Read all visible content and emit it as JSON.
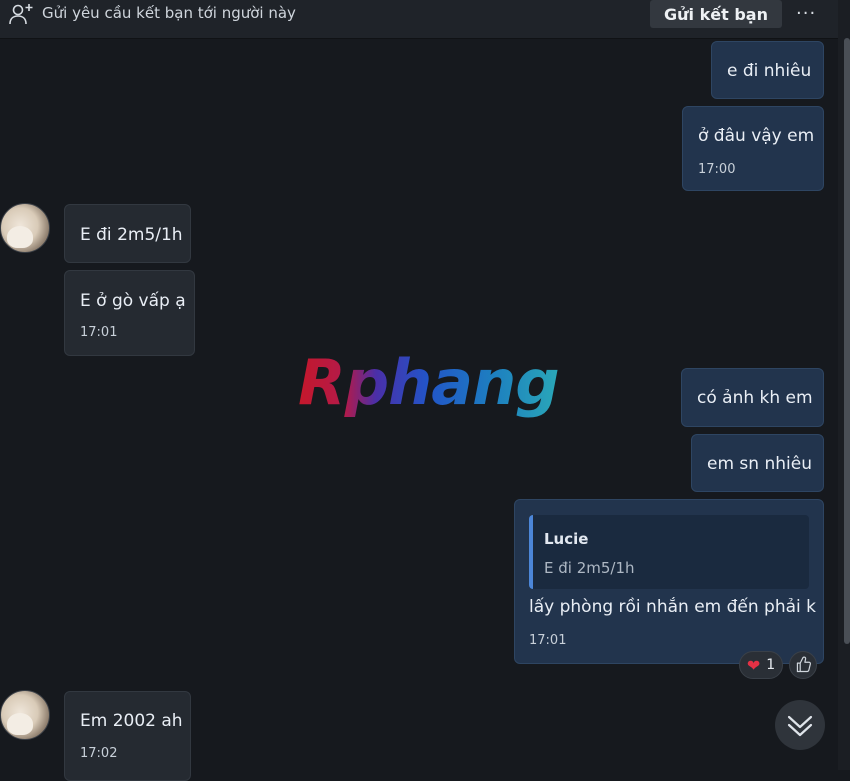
{
  "topbar": {
    "friend_request_text": "Gửi yêu cầu kết bạn tới người này",
    "add_friend_label": "Gửi kết bạn",
    "more_label": "···"
  },
  "messages": [
    {
      "dir": "out",
      "text": "e đi nhiêu",
      "time": ""
    },
    {
      "dir": "out",
      "text": "ở đâu vậy em",
      "time": "17:00"
    },
    {
      "dir": "in",
      "text": "E đi 2m5/1h",
      "time": ""
    },
    {
      "dir": "in",
      "text": "E ở gò vấp ạ",
      "time": "17:01"
    },
    {
      "dir": "out",
      "text": "có ảnh kh em",
      "time": ""
    },
    {
      "dir": "out",
      "text": "em sn nhiêu",
      "time": ""
    },
    {
      "dir": "out",
      "text": "lấy phòng rồi nhắn em đến phải k",
      "time": "17:01",
      "quote": {
        "name": "Lucie",
        "text": "E đi 2m5/1h"
      },
      "reaction": {
        "emoji": "❤",
        "count": "1"
      }
    },
    {
      "dir": "in",
      "text": "Em 2002 ah",
      "time": "17:02"
    }
  ],
  "watermark": "Rphang",
  "icons": {
    "add_friend": "person-add-icon",
    "more": "more-dots-icon",
    "like": "thumbs-up-icon",
    "scroll_down": "double-chevron-down-icon"
  },
  "colors": {
    "background": "#16191e",
    "outgoing_bubble": "#22344d",
    "incoming_bubble": "#252a31",
    "quote_accent": "#4c86d8",
    "heart": "#e53145"
  }
}
